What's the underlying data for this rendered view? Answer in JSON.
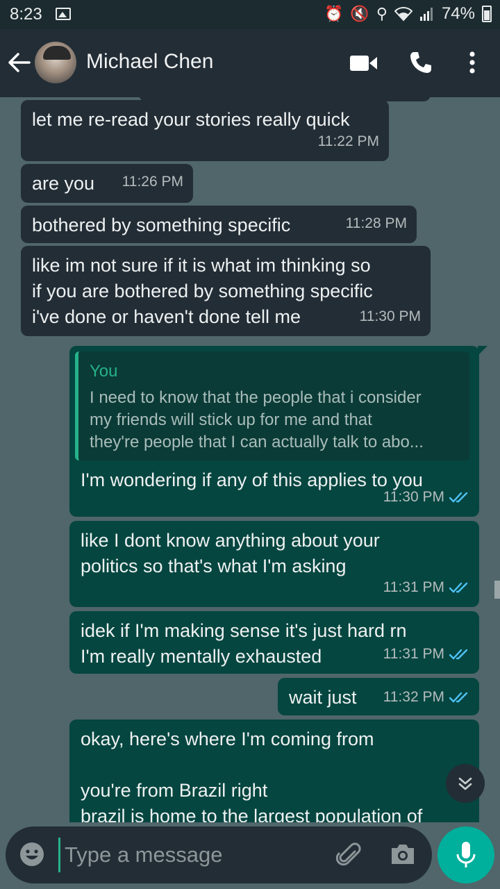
{
  "status_bar": {
    "time": "8:23",
    "battery": "74%",
    "icons": [
      "gallery-icon",
      "alarm-icon",
      "mute-icon",
      "location-icon",
      "wifi-icon",
      "signal-icon",
      "battery-icon"
    ]
  },
  "header": {
    "contact_name": "Michael Chen",
    "icons": [
      "back-arrow-icon",
      "video-call-icon",
      "phone-icon",
      "more-vert-icon"
    ]
  },
  "messages": [
    {
      "dir": "in",
      "text": "let me re-read your stories really quick",
      "time": "11:22 PM"
    },
    {
      "dir": "in",
      "text": "are you",
      "time": "11:26 PM"
    },
    {
      "dir": "in",
      "text": "bothered by something specific",
      "time": "11:28 PM"
    },
    {
      "dir": "in",
      "text": "like im not sure if it is what im thinking so\nif you are bothered by something specific\ni've done or haven't done tell me",
      "time": "11:30 PM"
    },
    {
      "dir": "out",
      "quote_name": "You",
      "quote_text": "I need to know that the people that i consider\nmy friends will stick up for me and that\nthey're people that I can actually talk to abo...",
      "text": "I'm wondering if any of this applies to you",
      "time": "11:30 PM"
    },
    {
      "dir": "out",
      "text": "like I dont know anything about your\npolitics so that's what I'm asking",
      "time": "11:31 PM"
    },
    {
      "dir": "out",
      "text": "idek if I'm making sense it's just hard rn\nI'm really mentally exhausted",
      "time": "11:31 PM"
    },
    {
      "dir": "out",
      "text": "wait just",
      "time": "11:32 PM"
    },
    {
      "dir": "out",
      "text": "okay, here's where I'm coming from\n\nyou're from Brazil right\nbrazil is home to the largest population of",
      "time": ""
    }
  ],
  "composer": {
    "placeholder": "Type a message"
  },
  "colors": {
    "incoming": "#232d36",
    "outgoing": "#054640",
    "accent": "#00af9c",
    "background": "#50666a"
  }
}
